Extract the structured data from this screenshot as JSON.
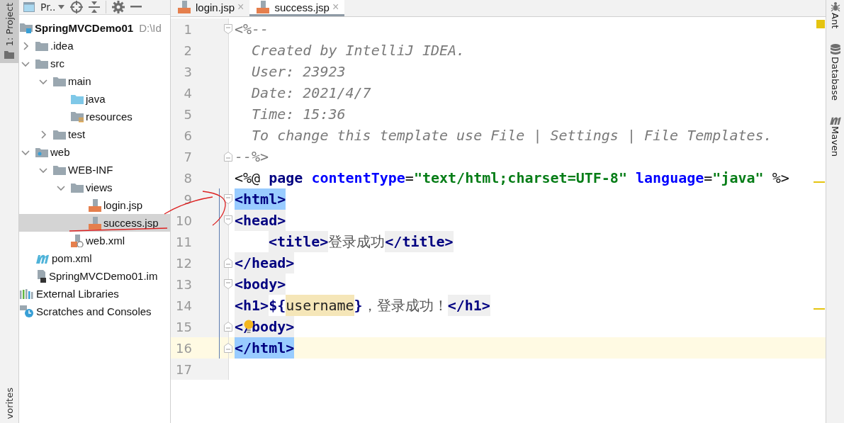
{
  "left_strip": {
    "top": [
      {
        "label": "1: Project",
        "selected": true
      }
    ],
    "bottom": [
      {
        "label": "vorites",
        "selected": false
      }
    ]
  },
  "project_panel": {
    "view_label": "Pr..",
    "root": {
      "name": "SpringMVCDemo01",
      "path": "D:\\Id",
      "kind": "module",
      "selected": false,
      "children": [
        {
          "name": ".idea",
          "kind": "folder",
          "expanded": false,
          "selected": false
        },
        {
          "name": "src",
          "kind": "folder",
          "expanded": true,
          "selected": false,
          "children": [
            {
              "name": "main",
              "kind": "folder",
              "expanded": true,
              "selected": false,
              "children": [
                {
                  "name": "java",
                  "kind": "source",
                  "selected": false
                },
                {
                  "name": "resources",
                  "kind": "resources",
                  "selected": false
                }
              ]
            },
            {
              "name": "test",
              "kind": "folder",
              "expanded": false,
              "selected": false
            }
          ]
        },
        {
          "name": "web",
          "kind": "web",
          "expanded": true,
          "selected": false,
          "children": [
            {
              "name": "WEB-INF",
              "kind": "folder",
              "expanded": true,
              "selected": false,
              "children": [
                {
                  "name": "views",
                  "kind": "folder",
                  "expanded": true,
                  "selected": false,
                  "children": [
                    {
                      "name": "login.jsp",
                      "kind": "jsp",
                      "selected": false
                    },
                    {
                      "name": "success.jsp",
                      "kind": "jsp",
                      "selected": true
                    }
                  ]
                },
                {
                  "name": "web.xml",
                  "kind": "xml",
                  "selected": false
                }
              ]
            }
          ]
        },
        {
          "name": "pom.xml",
          "kind": "maven",
          "selected": false
        },
        {
          "name": "SpringMVCDemo01.im",
          "kind": "iml",
          "selected": false
        }
      ]
    },
    "others": [
      {
        "name": "External Libraries",
        "kind": "libraries",
        "selected": false
      },
      {
        "name": "Scratches and Consoles",
        "kind": "scratches",
        "selected": false
      }
    ]
  },
  "tabs": [
    {
      "label": "login.jsp",
      "close": "×",
      "selected": false
    },
    {
      "label": "success.jsp",
      "close": "×",
      "selected": true
    }
  ],
  "editor": {
    "lines": [
      {
        "number": "1",
        "fold_start": true,
        "fold_end": false,
        "current": false,
        "indented": false,
        "tokens": [
          {
            "kind": "comment",
            "text": "<%--"
          }
        ]
      },
      {
        "number": "2",
        "fold_start": false,
        "fold_end": false,
        "current": false,
        "indented": false,
        "tokens": [
          {
            "kind": "comment",
            "text": "  Created by IntelliJ IDEA."
          }
        ]
      },
      {
        "number": "3",
        "fold_start": false,
        "fold_end": false,
        "current": false,
        "indented": false,
        "tokens": [
          {
            "kind": "comment",
            "text": "  User: 23923"
          }
        ]
      },
      {
        "number": "4",
        "fold_start": false,
        "fold_end": false,
        "current": false,
        "indented": false,
        "tokens": [
          {
            "kind": "comment",
            "text": "  Date: 2021/4/7"
          }
        ]
      },
      {
        "number": "5",
        "fold_start": false,
        "fold_end": false,
        "current": false,
        "indented": false,
        "tokens": [
          {
            "kind": "comment",
            "text": "  Time: 15:36"
          }
        ]
      },
      {
        "number": "6",
        "fold_start": false,
        "fold_end": false,
        "current": false,
        "indented": false,
        "tokens": [
          {
            "kind": "comment",
            "text": "  To change this template use File | Settings | File Templates."
          }
        ]
      },
      {
        "number": "7",
        "fold_start": false,
        "fold_end": true,
        "current": false,
        "indented": false,
        "tokens": [
          {
            "kind": "comment",
            "text": "--%>"
          }
        ]
      },
      {
        "number": "8",
        "fold_start": false,
        "fold_end": false,
        "current": false,
        "indented": false,
        "tokens": [
          {
            "kind": "directive",
            "text": "<%@ "
          },
          {
            "kind": "keyword",
            "text": "page "
          },
          {
            "kind": "attribute",
            "text": "contentType"
          },
          {
            "kind": "plain",
            "text": "="
          },
          {
            "kind": "string",
            "text": "\"text/html;charset=UTF-8\" "
          },
          {
            "kind": "attribute",
            "text": "language"
          },
          {
            "kind": "plain",
            "text": "="
          },
          {
            "kind": "string",
            "text": "\"java\" "
          },
          {
            "kind": "directive",
            "text": "%>"
          }
        ]
      },
      {
        "number": "9",
        "fold_start": true,
        "fold_end": false,
        "current": false,
        "indented": false,
        "tokens": [
          {
            "kind": "tag",
            "text": "<html>",
            "matched": true
          }
        ]
      },
      {
        "number": "10",
        "fold_start": true,
        "fold_end": false,
        "current": false,
        "indented": false,
        "tokens": [
          {
            "kind": "tag",
            "text": "<head>",
            "matched": false
          }
        ]
      },
      {
        "number": "11",
        "fold_start": false,
        "fold_end": false,
        "current": false,
        "indented": true,
        "tokens": [
          {
            "kind": "tag",
            "text": "<title>",
            "matched": false
          },
          {
            "kind": "text",
            "text": "登录成功"
          },
          {
            "kind": "tag",
            "text": "</title>",
            "matched": false
          }
        ]
      },
      {
        "number": "12",
        "fold_start": false,
        "fold_end": true,
        "current": false,
        "indented": false,
        "tokens": [
          {
            "kind": "tag",
            "text": "</head>",
            "matched": false
          }
        ]
      },
      {
        "number": "13",
        "fold_start": true,
        "fold_end": false,
        "current": false,
        "indented": false,
        "tokens": [
          {
            "kind": "tag",
            "text": "<body>",
            "matched": false
          }
        ]
      },
      {
        "number": "14",
        "fold_start": false,
        "fold_end": false,
        "current": false,
        "indented": false,
        "tokens": [
          {
            "kind": "tag",
            "text": "<h1>",
            "matched": false
          },
          {
            "kind": "el",
            "text": "${"
          },
          {
            "kind": "variable",
            "text": "username"
          },
          {
            "kind": "el",
            "text": "}"
          },
          {
            "kind": "text",
            "text": "，登录成功！"
          },
          {
            "kind": "tag",
            "text": "</h1>",
            "matched": false
          }
        ]
      },
      {
        "number": "15",
        "fold_start": false,
        "fold_end": true,
        "current": false,
        "indented": false,
        "intention": true,
        "tokens": [
          {
            "kind": "tag",
            "text": "</body>",
            "matched": false
          }
        ]
      },
      {
        "number": "16",
        "fold_start": false,
        "fold_end": true,
        "current": true,
        "indented": false,
        "tokens": [
          {
            "kind": "tag",
            "text": "</html>",
            "matched": true
          }
        ]
      },
      {
        "number": "17",
        "fold_start": false,
        "fold_end": false,
        "current": false,
        "indented": false
      }
    ]
  },
  "right_strip": [
    {
      "label": "Ant",
      "kind": "ant"
    },
    {
      "label": "Database",
      "kind": "database"
    },
    {
      "label": "Maven",
      "kind": "maven"
    }
  ]
}
